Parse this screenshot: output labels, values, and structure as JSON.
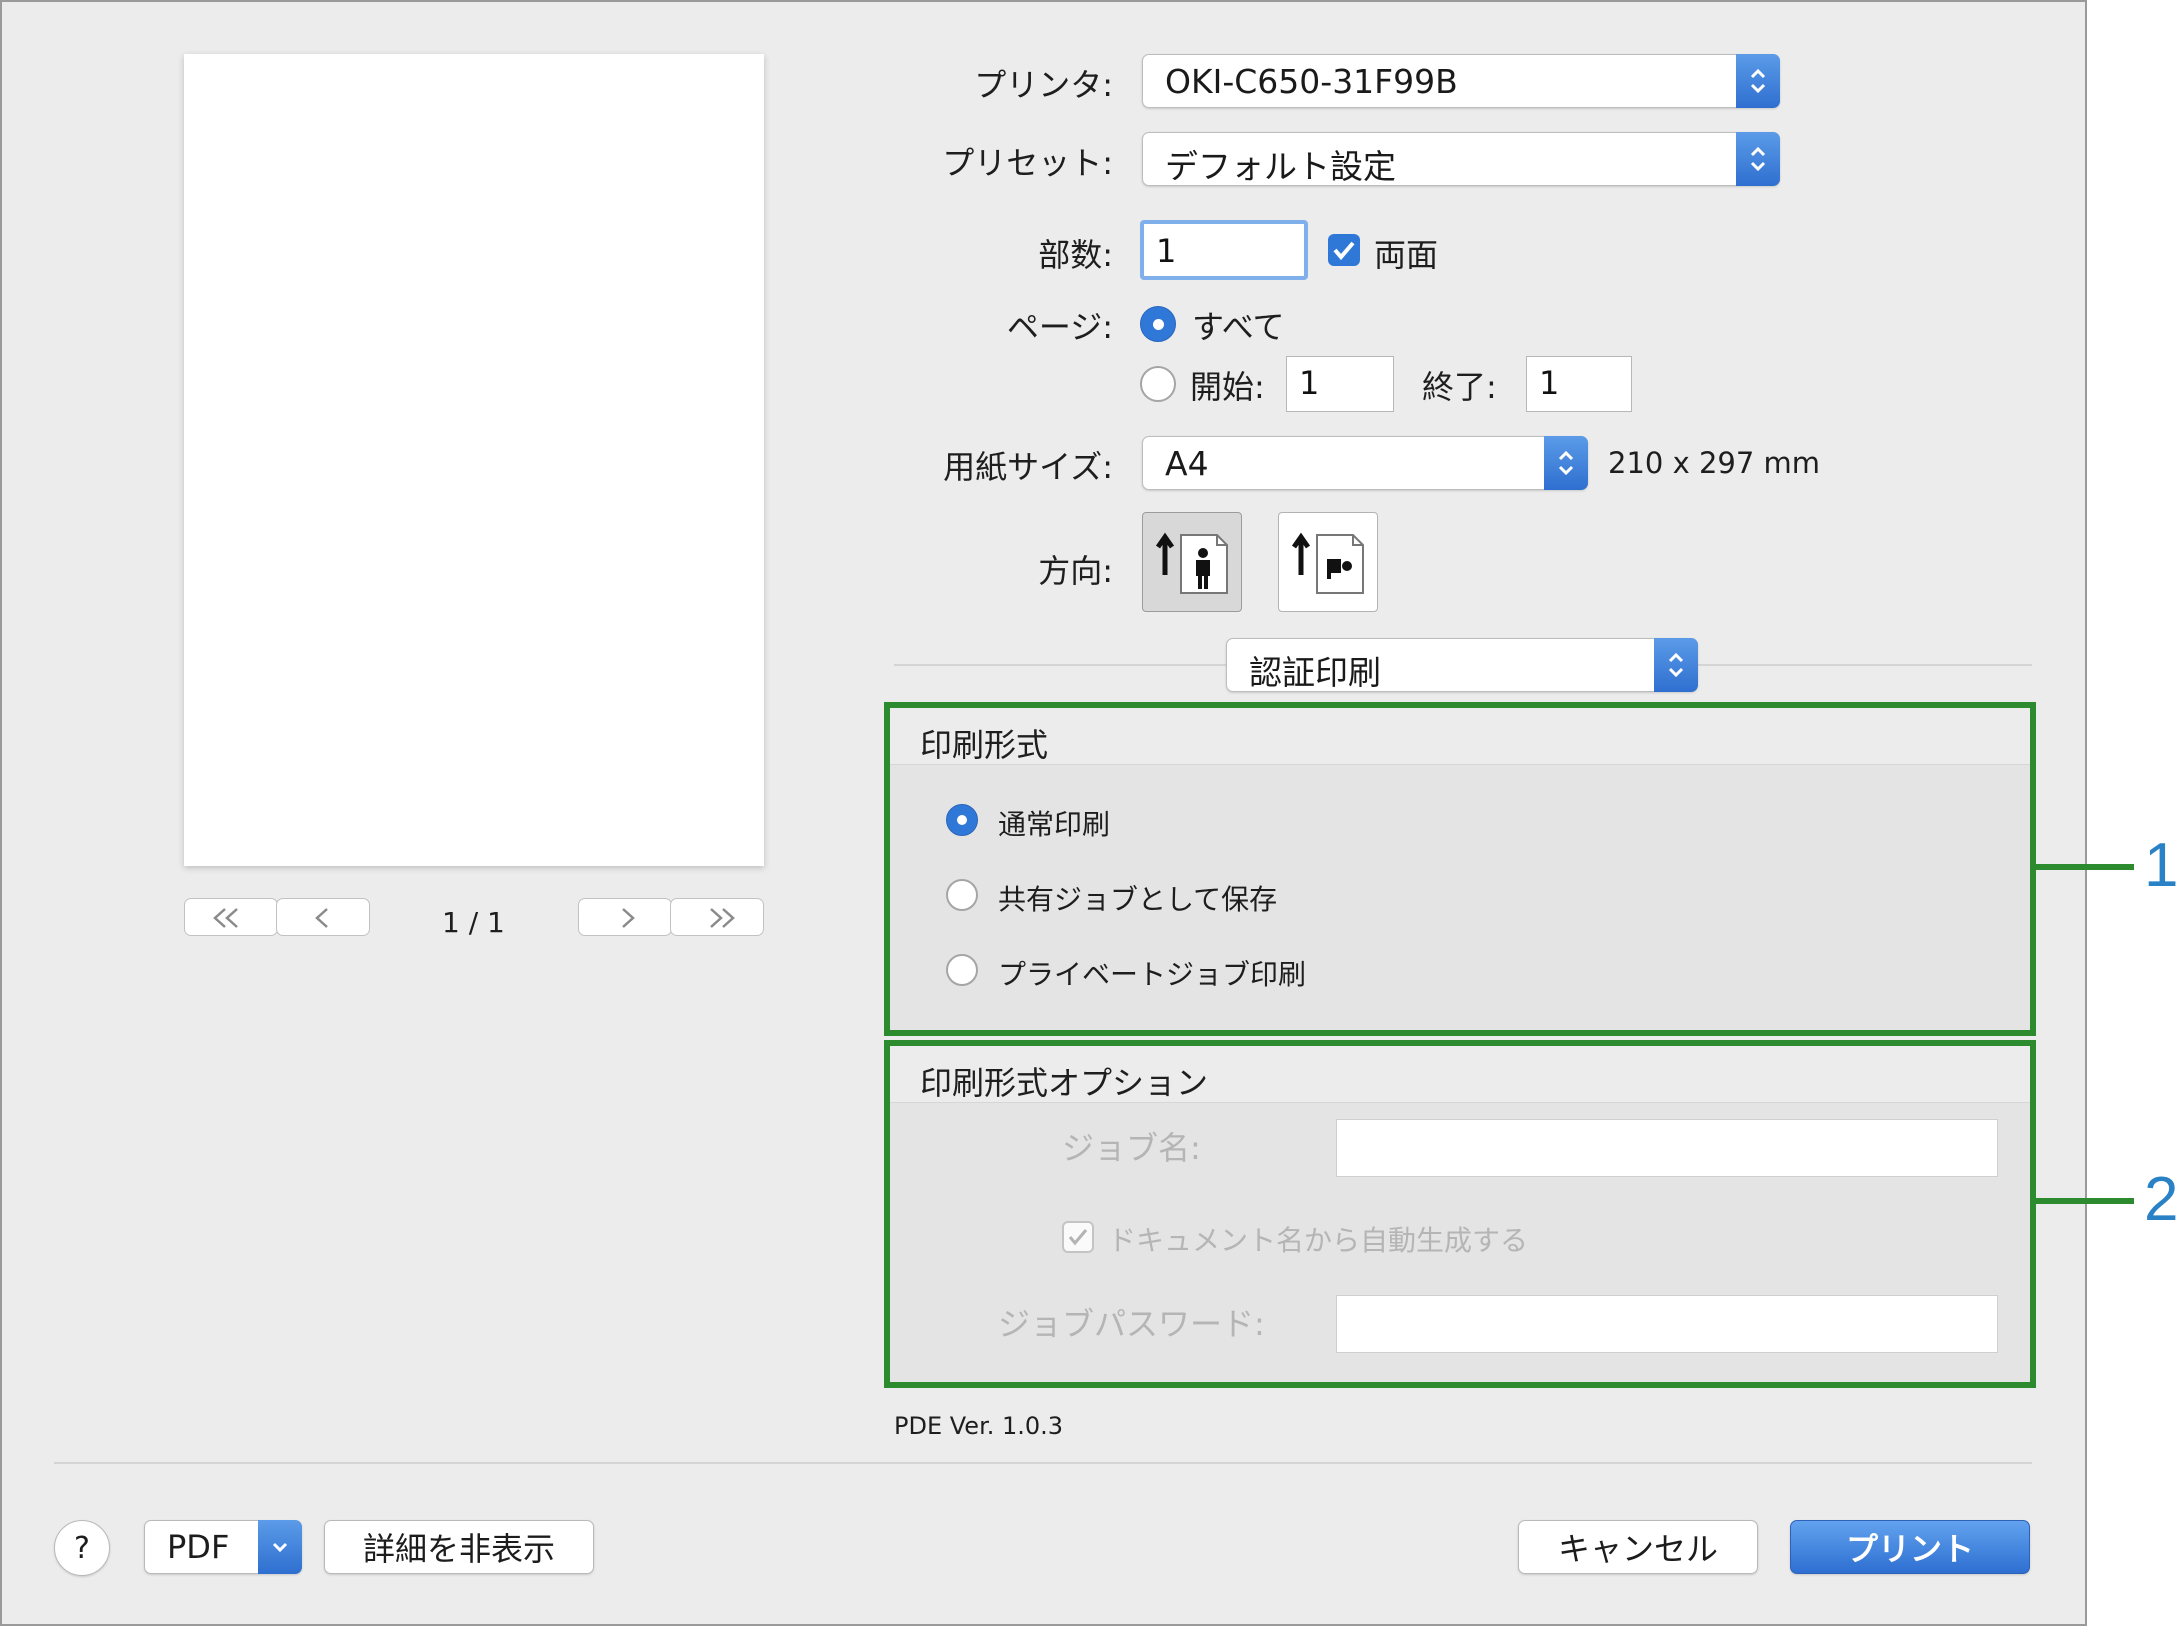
{
  "printer": {
    "label": "プリンタ:",
    "value": "OKI-C650-31F99B"
  },
  "preset": {
    "label": "プリセット:",
    "value": "デフォルト設定"
  },
  "copies": {
    "label": "部数:",
    "value": "1",
    "duplex_label": "両面",
    "duplex_checked": true
  },
  "pages": {
    "label": "ページ:",
    "all_label": "すべて",
    "from_label": "開始:",
    "from_value": "1",
    "to_label": "終了:",
    "to_value": "1"
  },
  "paper": {
    "label": "用紙サイズ:",
    "value": "A4",
    "dimensions": "210 x 297 mm"
  },
  "orientation": {
    "label": "方向:",
    "selected": "portrait"
  },
  "panel_select": {
    "value": "認証印刷"
  },
  "print_mode": {
    "title": "印刷形式",
    "options": [
      "通常印刷",
      "共有ジョブとして保存",
      "プライベートジョブ印刷"
    ],
    "selected": 0
  },
  "print_mode_options": {
    "title": "印刷形式オプション",
    "job_name_label": "ジョブ名:",
    "auto_name_label": "ドキュメント名から自動生成する",
    "job_password_label": "ジョブパスワード:"
  },
  "preview": {
    "page_indicator": "1 / 1"
  },
  "version": "PDE Ver. 1.0.3",
  "footer": {
    "help_label": "?",
    "pdf_label": "PDF",
    "hide_details_label": "詳細を非表示",
    "cancel_label": "キャンセル",
    "print_label": "プリント"
  },
  "callouts": [
    "1",
    "2"
  ],
  "colors": {
    "accent": "#2f78d8",
    "highlight_frame": "#2c8a2f",
    "callout_text": "#2a82c6"
  }
}
